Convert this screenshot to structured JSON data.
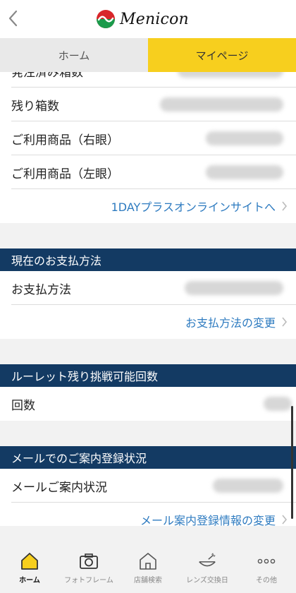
{
  "header": {
    "back_icon": "chevron-left-icon",
    "logo_text": "Menicon"
  },
  "tabs": [
    {
      "label": "ホーム",
      "active": false
    },
    {
      "label": "マイページ",
      "active": true
    }
  ],
  "subscription": {
    "rows": [
      {
        "label": "発注済み箱数"
      },
      {
        "label": "残り箱数"
      },
      {
        "label": "ご利用商品（右眼）"
      },
      {
        "label": "ご利用商品（左眼）"
      }
    ],
    "link": "1DAYプラスオンラインサイトへ"
  },
  "payment": {
    "title": "現在のお支払方法",
    "row_label": "お支払方法",
    "link": "お支払方法の変更"
  },
  "roulette": {
    "title": "ルーレット残り挑戦可能回数",
    "row_label": "回数"
  },
  "mail": {
    "title": "メールでのご案内登録状況",
    "row_label": "メールご案内状況",
    "link": "メール案内登録情報の変更"
  },
  "bottom_nav": [
    {
      "label": "ホーム",
      "icon": "home-icon",
      "active": true
    },
    {
      "label": "フォトフレーム",
      "icon": "camera-icon",
      "active": false
    },
    {
      "label": "店舗検索",
      "icon": "store-icon",
      "active": false
    },
    {
      "label": "レンズ交換日",
      "icon": "lens-case-icon",
      "active": false
    },
    {
      "label": "その他",
      "icon": "more-icon",
      "active": false
    }
  ],
  "colors": {
    "accent_yellow": "#f7cf1e",
    "section_navy": "#133a63",
    "link_blue": "#2e7bc0"
  }
}
